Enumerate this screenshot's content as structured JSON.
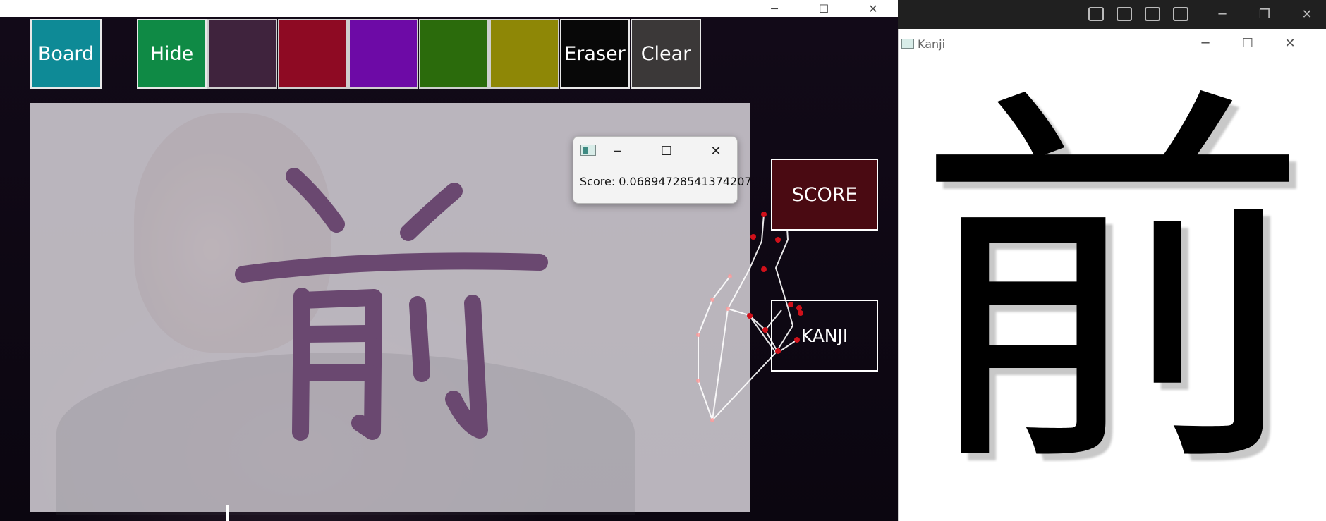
{
  "left_window": {
    "controls": {
      "minimize": "─",
      "maximize": "☐",
      "close": "✕"
    },
    "toolbar": {
      "board": {
        "label": "Board",
        "color": "#0e8a96"
      },
      "hide": {
        "label": "Hide",
        "color": "#0f8a45"
      },
      "swatches": [
        {
          "name": "plum",
          "color": "#3f233d"
        },
        {
          "name": "crimson",
          "color": "#8e0a23"
        },
        {
          "name": "violet",
          "color": "#6d0aa6"
        },
        {
          "name": "green",
          "color": "#2b6b0c"
        },
        {
          "name": "olive",
          "color": "#8e8706"
        }
      ],
      "eraser": {
        "label": "Eraser",
        "color": "#080808"
      },
      "clear": {
        "label": "Clear",
        "color": "#3b3838"
      }
    },
    "ink_color": "#6a4870",
    "buttons": {
      "score": {
        "label": "SCORE",
        "color": "#4a0a12"
      },
      "kanji": {
        "label": "KANJI"
      }
    }
  },
  "score_dialog": {
    "text": "Score: 0.06894728541374207",
    "controls": {
      "minimize": "─",
      "maximize": "☐",
      "close": "✕"
    }
  },
  "kanji_window": {
    "title": "Kanji",
    "character": "前",
    "controls": {
      "minimize": "─",
      "maximize": "☐",
      "close": "✕"
    }
  },
  "taskbar_right": {
    "controls": {
      "minimize": "─",
      "restore": "❐",
      "close": "✕"
    }
  }
}
